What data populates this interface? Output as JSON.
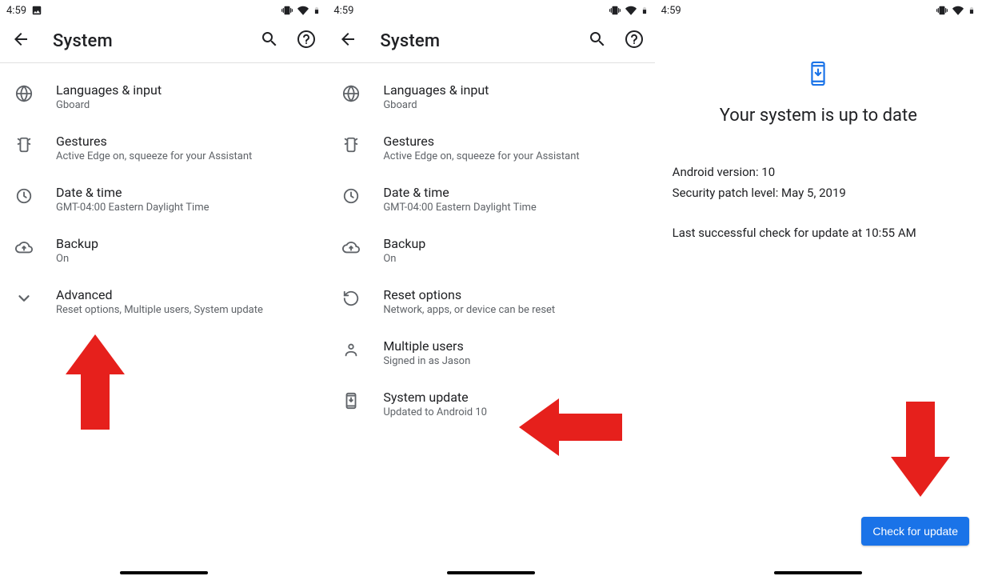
{
  "status": {
    "time": "4:59"
  },
  "topbar": {
    "title": "System"
  },
  "pane1": {
    "items": [
      {
        "label": "Languages & input",
        "sub": "Gboard"
      },
      {
        "label": "Gestures",
        "sub": "Active Edge on, squeeze for your Assistant"
      },
      {
        "label": "Date & time",
        "sub": "GMT-04:00 Eastern Daylight Time"
      },
      {
        "label": "Backup",
        "sub": "On"
      },
      {
        "label": "Advanced",
        "sub": "Reset options, Multiple users, System update"
      }
    ]
  },
  "pane2": {
    "items": [
      {
        "label": "Languages & input",
        "sub": "Gboard"
      },
      {
        "label": "Gestures",
        "sub": "Active Edge on, squeeze for your Assistant"
      },
      {
        "label": "Date & time",
        "sub": "GMT-04:00 Eastern Daylight Time"
      },
      {
        "label": "Backup",
        "sub": "On"
      },
      {
        "label": "Reset options",
        "sub": "Network, apps, or device can be reset"
      },
      {
        "label": "Multiple users",
        "sub": "Signed in as Jason"
      },
      {
        "label": "System update",
        "sub": "Updated to Android 10"
      }
    ]
  },
  "pane3": {
    "title": "Your system is up to date",
    "android_line": "Android version: 10",
    "patch_line": "Security patch level: May 5, 2019",
    "last_check": "Last successful check for update at 10:55 AM",
    "button": "Check for update"
  }
}
